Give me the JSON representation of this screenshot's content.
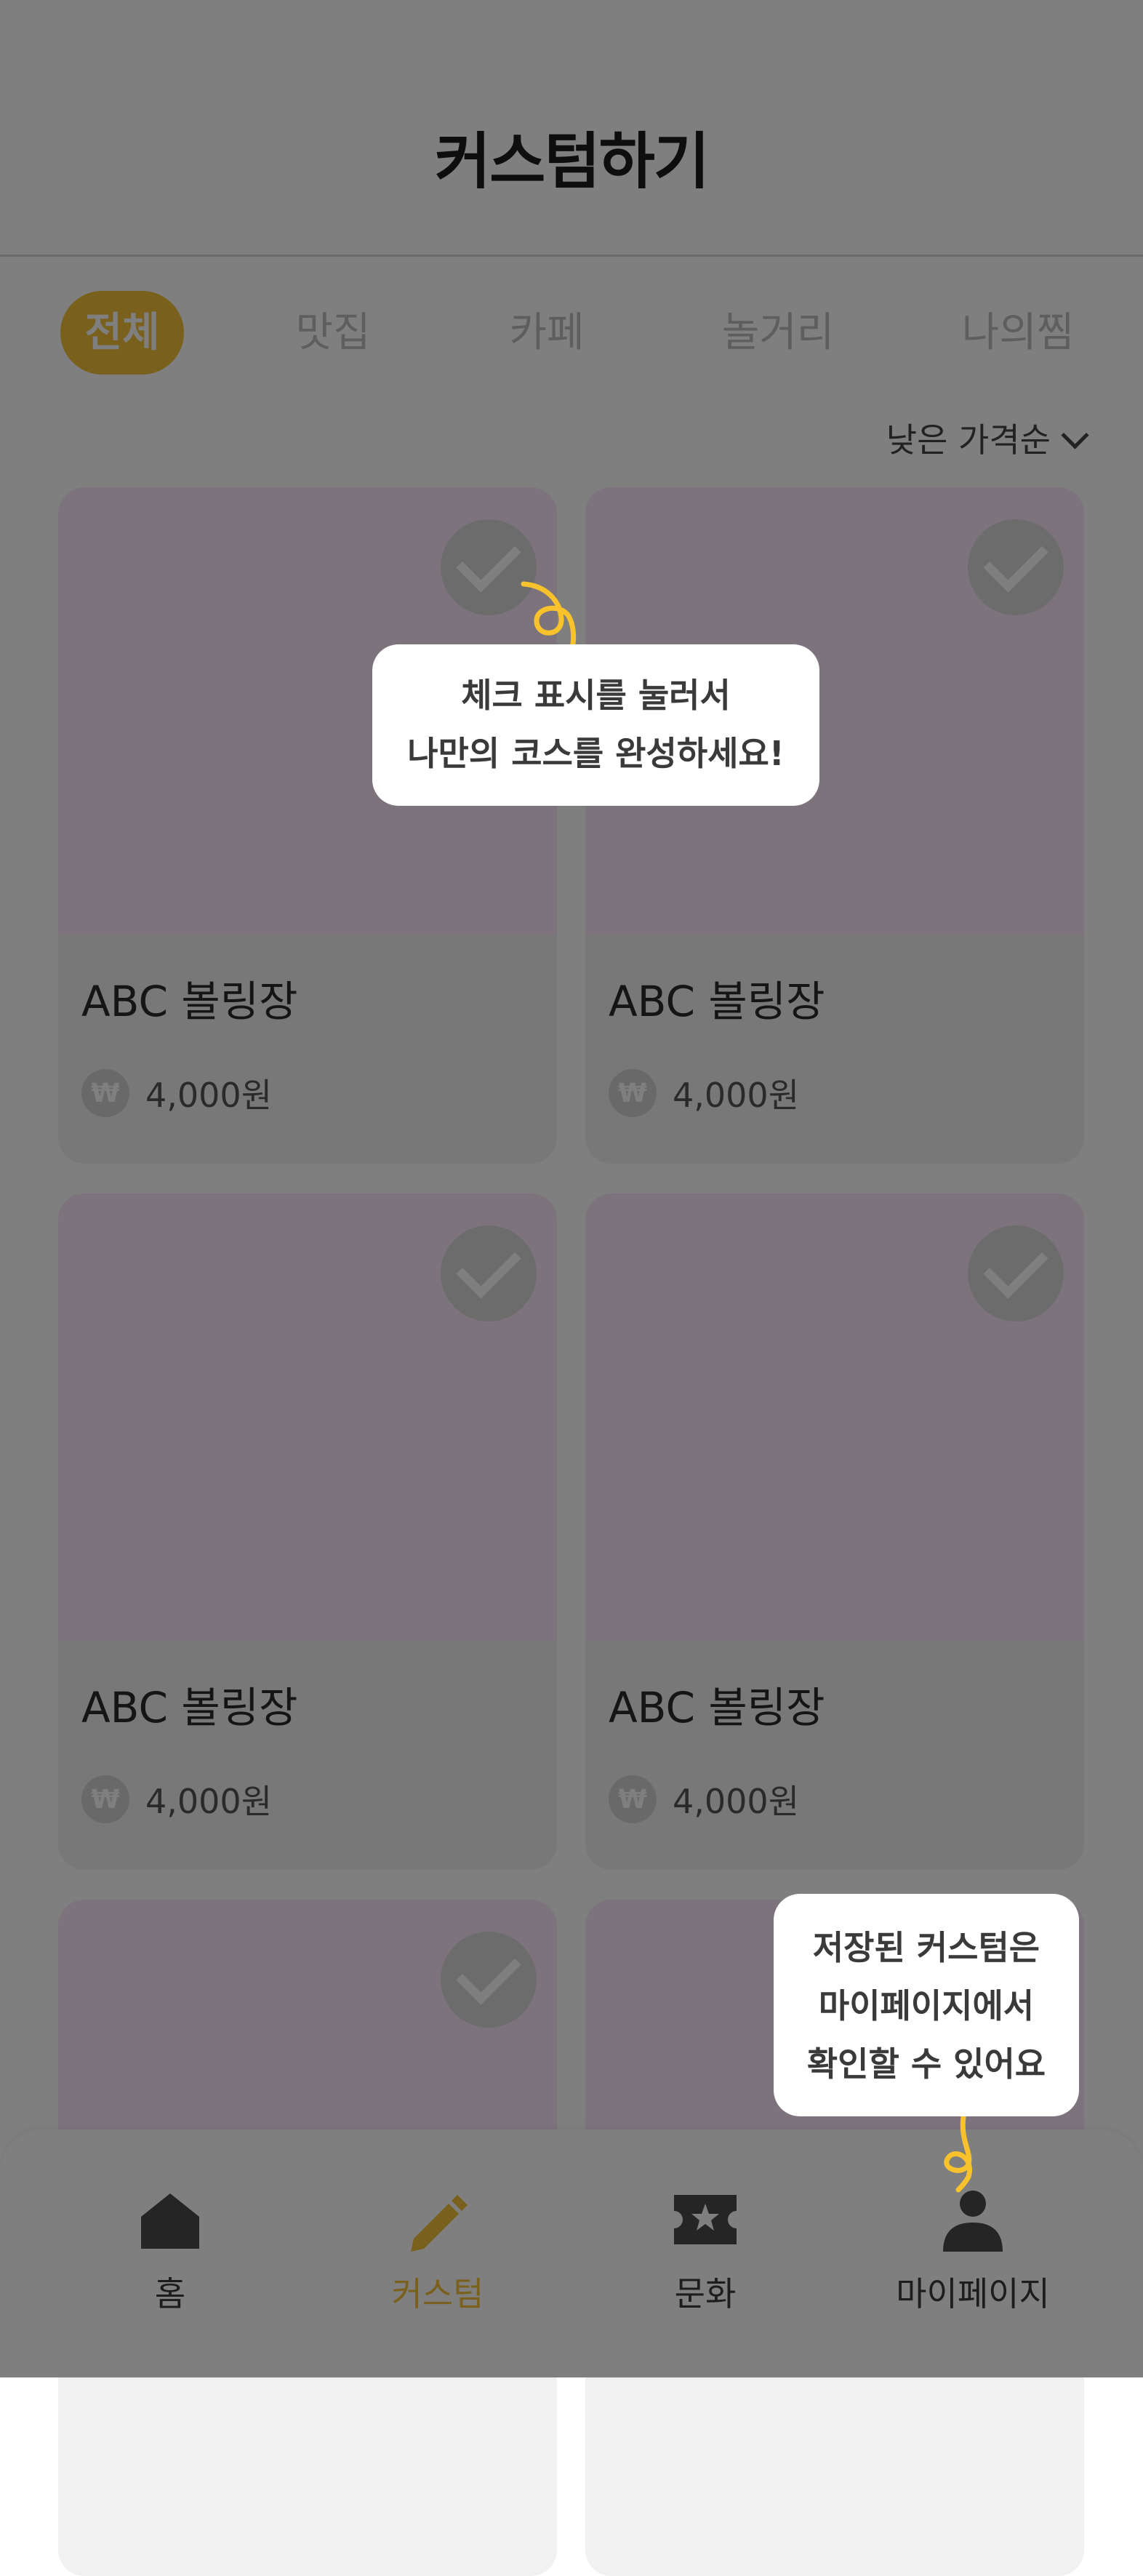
{
  "header": {
    "title": "커스텀하기"
  },
  "tabs": [
    {
      "label": "전체",
      "active": true
    },
    {
      "label": "맛집",
      "active": false
    },
    {
      "label": "카페",
      "active": false
    },
    {
      "label": "놀거리",
      "active": false
    },
    {
      "label": "나의찜",
      "active": false
    }
  ],
  "sort": {
    "label": "낮은 가격순",
    "icon": "chevron-down-icon"
  },
  "cards": [
    {
      "title": "ABC 볼링장",
      "price": "4,000원",
      "currency_symbol": "₩",
      "check_icon": "check-icon"
    },
    {
      "title": "ABC 볼링장",
      "price": "4,000원",
      "currency_symbol": "₩",
      "check_icon": "check-icon"
    },
    {
      "title": "ABC 볼링장",
      "price": "4,000원",
      "currency_symbol": "₩",
      "check_icon": "check-icon"
    },
    {
      "title": "ABC 볼링장",
      "price": "4,000원",
      "currency_symbol": "₩",
      "check_icon": "check-icon"
    },
    {
      "title": "",
      "price": "",
      "currency_symbol": "",
      "check_icon": "check-icon"
    },
    {
      "title": "",
      "price": "",
      "currency_symbol": "",
      "check_icon": ""
    }
  ],
  "tooltips": {
    "check": {
      "line1": "체크 표시를 눌러서",
      "line2": "나만의 코스를 완성하세요!"
    },
    "mypage": {
      "line1": "저장된 커스텀은",
      "line2": "마이페이지에서",
      "line3": "확인할 수 있어요"
    }
  },
  "nav": [
    {
      "label": "홈",
      "icon": "home-icon",
      "active": false
    },
    {
      "label": "커스텀",
      "icon": "pencil-icon",
      "active": true
    },
    {
      "label": "문화",
      "icon": "ticket-star-icon",
      "active": false
    },
    {
      "label": "마이페이지",
      "icon": "person-icon",
      "active": false
    }
  ],
  "colors": {
    "accent": "#f2c03b",
    "card_image": "#fbe7fb",
    "card_body": "#f1f1f1",
    "overlay": "rgba(0,0,0,0.5)"
  }
}
